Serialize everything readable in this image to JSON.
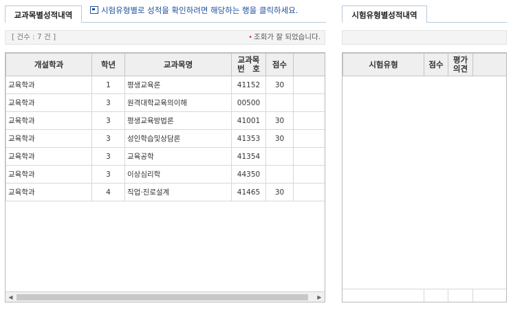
{
  "left_panel": {
    "tab_label": "교과목별성적내역",
    "hint": "시험유형별로 성적을 확인하려면 해당하는 행을 클릭하세요.",
    "count": "[ 건수 : 7 건 ]",
    "status": "조회가 잘 되었습니다.",
    "columns": [
      "개설학과",
      "학년",
      "교과목명",
      "교과목\n번　호",
      "점수"
    ],
    "rows": [
      {
        "dept": "교육학과",
        "year": "1",
        "course": "평생교육론",
        "code": "41152",
        "score": "30"
      },
      {
        "dept": "교육학과",
        "year": "3",
        "course": "원격대학교육의이해",
        "code": "00500",
        "score": ""
      },
      {
        "dept": "교육학과",
        "year": "3",
        "course": "평생교육방법론",
        "code": "41001",
        "score": "30"
      },
      {
        "dept": "교육학과",
        "year": "3",
        "course": "성인학습및상담론",
        "code": "41353",
        "score": "30"
      },
      {
        "dept": "교육학과",
        "year": "3",
        "course": "교육공학",
        "code": "41354",
        "score": ""
      },
      {
        "dept": "교육학과",
        "year": "3",
        "course": "이상심리학",
        "code": "44350",
        "score": ""
      },
      {
        "dept": "교육학과",
        "year": "4",
        "course": "직업·진로설계",
        "code": "41465",
        "score": "30"
      }
    ],
    "scroll_left": "◀",
    "scroll_right": "▶"
  },
  "right_panel": {
    "tab_label": "시험유형별성적내역",
    "columns": [
      "시험유형",
      "점수",
      "평가\n의견"
    ]
  },
  "colors": {
    "tab_border": "#b5c9df",
    "hint_text": "#1e4f9c",
    "status_dot": "#e0352b",
    "header_bg": "#efefef"
  }
}
